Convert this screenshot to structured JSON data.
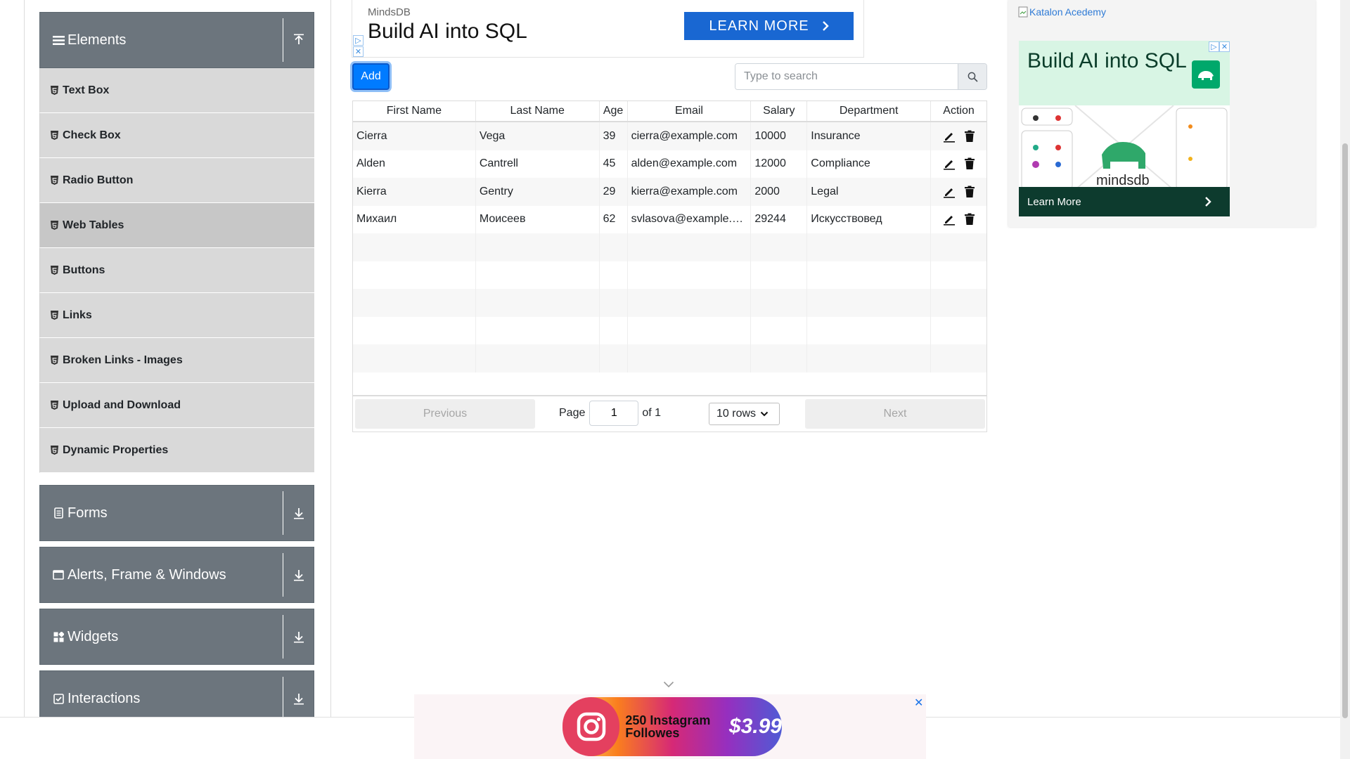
{
  "sidebar": {
    "elements_group": {
      "label": "Elements"
    },
    "items": [
      {
        "label": "Text Box"
      },
      {
        "label": "Check Box"
      },
      {
        "label": "Radio Button"
      },
      {
        "label": "Web Tables"
      },
      {
        "label": "Buttons"
      },
      {
        "label": "Links"
      },
      {
        "label": "Broken Links - Images"
      },
      {
        "label": "Upload and Download"
      },
      {
        "label": "Dynamic Properties"
      }
    ],
    "groups": [
      {
        "label": "Forms",
        "icon": "document-icon"
      },
      {
        "label": "Alerts, Frame & Windows",
        "icon": "window-icon"
      },
      {
        "label": "Widgets",
        "icon": "widgets-icon"
      },
      {
        "label": "Interactions",
        "icon": "interactions-icon"
      }
    ]
  },
  "top_ad": {
    "brand": "MindsDB",
    "headline": "Build AI into SQL",
    "cta": "LEARN MORE"
  },
  "toolbar": {
    "add_label": "Add",
    "search_placeholder": "Type to search"
  },
  "table": {
    "headers": [
      "First Name",
      "Last Name",
      "Age",
      "Email",
      "Salary",
      "Department",
      "Action"
    ],
    "rows": [
      [
        "Cierra",
        "Vega",
        "39",
        "cierra@example.com",
        "10000",
        "Insurance"
      ],
      [
        "Alden",
        "Cantrell",
        "45",
        "alden@example.com",
        "12000",
        "Compliance"
      ],
      [
        "Kierra",
        "Gentry",
        "29",
        "kierra@example.com",
        "2000",
        "Legal"
      ],
      [
        "Михаил",
        "Моисеев",
        "62",
        "svlasova@example.…",
        "29244",
        "Искусствовед"
      ]
    ]
  },
  "pagination": {
    "previous": "Previous",
    "page_label": "Page",
    "page_value": "1",
    "of_label": "of 1",
    "rows_option": "10 rows",
    "next": "Next"
  },
  "right_ad": {
    "link_text": "Katalon Acedemy",
    "headline": "Build AI into SQL",
    "brand_word": "mindsdb",
    "cta": "Learn More"
  },
  "bottom_ad": {
    "text": "250 Instagram Followes",
    "price": "$3.99"
  },
  "colors": {
    "sidebar_header": "#6c757d",
    "sidebar_item": "#d9d9d9",
    "primary": "#007bff",
    "ad_cta": "#1967d2"
  }
}
